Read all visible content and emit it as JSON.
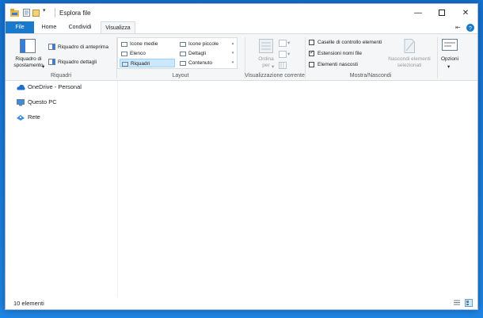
{
  "title": "Esplora file",
  "tabs": {
    "file": "File",
    "home": "Home",
    "share": "Condividi",
    "view": "Visualizza"
  },
  "ribbon": {
    "panes": {
      "navigation_pane": "Riquadro di spostamento",
      "preview_pane": "Riquadro di anteprima",
      "details_pane": "Riquadro dettagli",
      "group_label": "Riquadri"
    },
    "layout": {
      "items": [
        "Icone medie",
        "Elenco",
        "Riquadri",
        "Icone piccole",
        "Dettagli",
        "Contenuto"
      ],
      "selected": "Riquadri",
      "group_label": "Layout"
    },
    "current_view": {
      "sort_by": "Ordina per",
      "group_label": "Visualizzazione corrente"
    },
    "show_hide": {
      "checkboxes": [
        {
          "label": "Caselle di controllo elementi",
          "checked": false
        },
        {
          "label": "Estensioni nomi file",
          "checked": true
        },
        {
          "label": "Elementi nascosti",
          "checked": false
        }
      ],
      "hide_selected": "Nascondi elementi selezionati",
      "group_label": "Mostra/Nascondi"
    },
    "options": "Opzioni"
  },
  "nav": {
    "items": [
      {
        "label": "OneDrive - Personal",
        "icon": "cloud-icon"
      },
      {
        "label": "Questo PC",
        "icon": "computer-icon"
      },
      {
        "label": "Rete",
        "icon": "network-icon"
      }
    ]
  },
  "status": {
    "count": "10 elementi"
  },
  "colors": {
    "accent": "#1979ca",
    "desktop": "#1573d3",
    "selection": "#cce8ff"
  }
}
